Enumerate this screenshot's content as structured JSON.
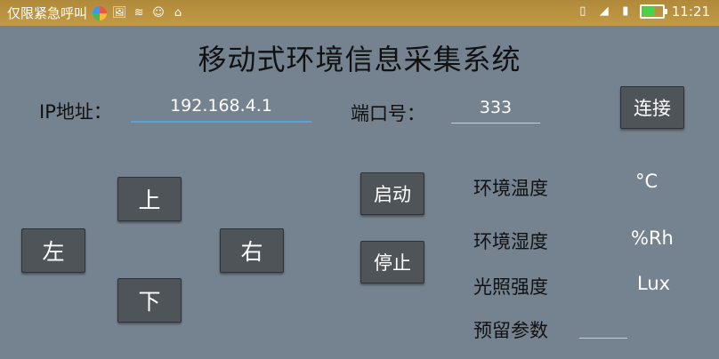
{
  "status_bar": {
    "carrier": "仅限紧急呼叫",
    "time": "11:21",
    "left_icons": [
      "app-color-icon",
      "image-icon",
      "wifi-icon",
      "chat-icon",
      "android-icon"
    ],
    "right_icons": [
      "vibrate-icon",
      "no-signal-icon",
      "sim-icon",
      "battery-icon"
    ]
  },
  "title": "移动式环境信息采集系统",
  "connection": {
    "ip_label": "IP地址：",
    "ip_value": "192.168.4.1",
    "port_label": "端口号：",
    "port_value": "333",
    "connect_label": "连接"
  },
  "direction": {
    "up": "上",
    "left": "左",
    "right": "右",
    "down": "下"
  },
  "control": {
    "start": "启动",
    "stop": "停止"
  },
  "sensors": [
    {
      "label": "环境温度",
      "unit": "°C"
    },
    {
      "label": "环境湿度",
      "unit": "%Rh"
    },
    {
      "label": "光照强度",
      "unit": "Lux"
    },
    {
      "label": "预留参数",
      "unit": ""
    }
  ]
}
